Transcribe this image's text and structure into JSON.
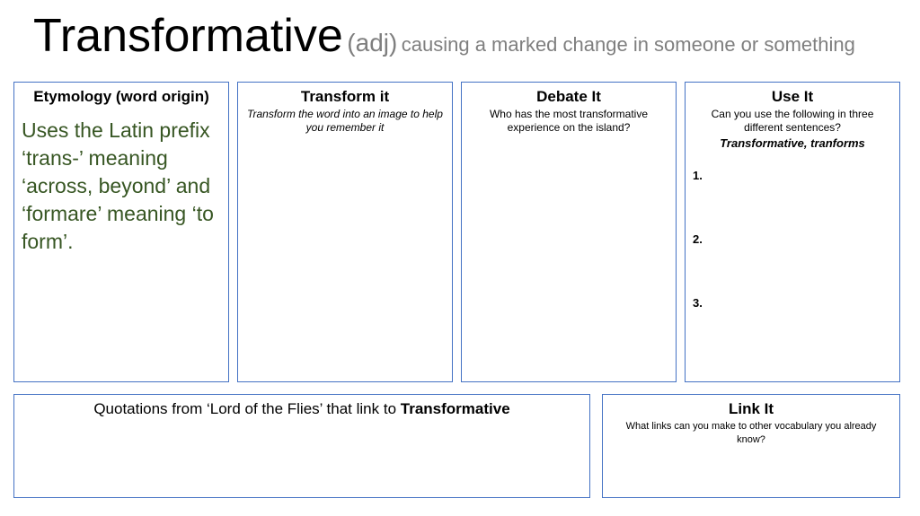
{
  "title": {
    "word": "Transformative",
    "pos": "(adj)",
    "definition": "causing a marked change in someone or something"
  },
  "etymology": {
    "heading": "Etymology (word origin)",
    "text": "Uses the Latin prefix ‘trans-’ meaning ‘across, beyond’ and ‘formare’ meaning ‘to form’."
  },
  "transform": {
    "heading": "Transform it",
    "sub": "Transform the word into an image to help you remember it"
  },
  "debate": {
    "heading": "Debate It",
    "sub": "Who has the most transformative experience on the island?"
  },
  "use": {
    "heading": "Use It",
    "sub": "Can you use the following in three different sentences?",
    "words": "Transformative, tranforms",
    "numbers": [
      "1.",
      "2.",
      "3."
    ]
  },
  "quotes": {
    "heading_prefix": "Quotations from ‘Lord of the Flies’ that link to",
    "heading_word": "Transformative"
  },
  "link": {
    "heading": "Link It",
    "sub": "What links can you make to other vocabulary you already know?"
  },
  "colors": {
    "border": "#4472c4",
    "etymology_text": "#375623",
    "subtitle_grey": "#7f7f7f"
  }
}
